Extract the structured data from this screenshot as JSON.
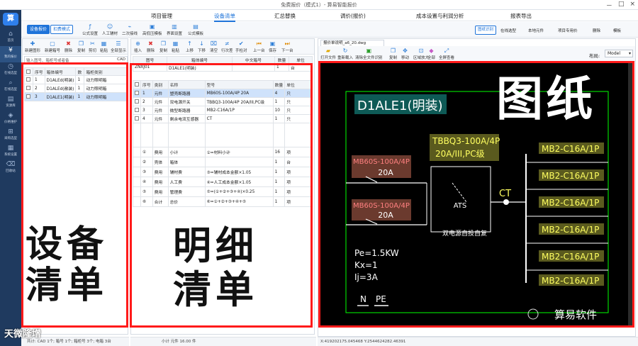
{
  "window": {
    "title": "免费报价（模式1）- 算易智能报价",
    "controls": [
      "－",
      "□",
      "×"
    ]
  },
  "nav": {
    "logo": "算",
    "items": [
      {
        "icon": "home-icon",
        "glyph": "⌂",
        "label": "首页"
      },
      {
        "icon": "quote-icon",
        "glyph": "¥",
        "label": "我的报价"
      },
      {
        "icon": "clock-icon",
        "glyph": "◷",
        "label": "在线选型"
      },
      {
        "icon": "search-icon",
        "glyph": "⌕",
        "label": "在线选型"
      },
      {
        "icon": "book-icon",
        "glyph": "▤",
        "label": "资源库"
      },
      {
        "icon": "tag-icon",
        "glyph": "◈",
        "label": "价格维护"
      },
      {
        "icon": "cart-icon",
        "glyph": "⊞",
        "label": "采购选型"
      },
      {
        "icon": "grid-icon",
        "glyph": "▦",
        "label": "系统设置"
      },
      {
        "icon": "trash-icon",
        "glyph": "⌫",
        "label": "回收站"
      }
    ]
  },
  "menu": {
    "items": [
      "项目管理",
      "设备清单",
      "汇总替换",
      "调价(报价)",
      "成本设置与利润分析",
      "报表导出"
    ],
    "active_index": 1
  },
  "mode": {
    "on": "设备报价",
    "off": "扣费模式"
  },
  "toolbar_main": [
    {
      "icon": "formula-icon",
      "label": "公式设置"
    },
    {
      "icon": "labor-icon",
      "label": "人工辅材"
    },
    {
      "icon": "secondary-icon",
      "label": "二次接线"
    },
    {
      "icon": "price-icon",
      "label": "高低压模板"
    },
    {
      "icon": "layout-icon",
      "label": "界面设置"
    },
    {
      "icon": "template-icon",
      "label": "公式模板"
    }
  ],
  "toolbar_right": [
    "图纸识别",
    "在线选型",
    "本地元件",
    "项目专用价",
    "删除",
    "模板"
  ],
  "left_toolbar": [
    "新建图形",
    "新建箱号",
    "删除",
    "复制",
    "剪切",
    "粘贴",
    "全部显示"
  ],
  "left_filter": {
    "label": "输入图号、箱柜号或者备",
    "cad": "CAD"
  },
  "left_table": {
    "headers": [
      "序号",
      "箱体编号",
      "数",
      "箱柜类别"
    ],
    "rows": [
      {
        "no": "1",
        "code": "D1ALEd(明装)",
        "qty": "1",
        "type": "动力照明箱",
        "sel": false
      },
      {
        "no": "2",
        "code": "D1ALEd(敞装)",
        "qty": "1",
        "type": "动力照明箱",
        "sel": false
      },
      {
        "no": "3",
        "code": "D1ALE1(明装)",
        "qty": "1",
        "type": "动力照明箱",
        "sel": true
      }
    ]
  },
  "mid_toolbar": [
    "插入",
    "删除",
    "复制",
    "粘贴",
    "上移",
    "下移",
    "清空",
    "行次差",
    "手检对",
    "上一台",
    "保存",
    "下一台"
  ],
  "mid_header_fields": [
    "图号",
    "箱体编号",
    "中文箱号",
    "数量",
    "单位"
  ],
  "mid_header_values": [
    "ZNXJ01",
    "D1ALE1(明装)",
    "",
    "1",
    "台"
  ],
  "mid_table": {
    "headers": [
      "序号",
      "类别",
      "名称",
      "型号",
      "数量",
      "单位"
    ],
    "rows": [
      {
        "no": "1",
        "cat": "元件",
        "name": "塑壳断路器",
        "model": "MB60S-100A/4P 20A",
        "qty": "4",
        "unit": "只",
        "sel": true
      },
      {
        "no": "2",
        "cat": "元件",
        "name": "双电源开关",
        "model": "TBBQ3-100A/4P 20A/III,PC级",
        "qty": "1",
        "unit": "只",
        "sel": false
      },
      {
        "no": "3",
        "cat": "元件",
        "name": "微型断路器",
        "model": "MB2-C16A/1P",
        "qty": "10",
        "unit": "只",
        "sel": false
      },
      {
        "no": "4",
        "cat": "元件",
        "name": "剩余电流互感器",
        "model": "CT",
        "qty": "1",
        "unit": "只",
        "sel": false
      }
    ],
    "fee_rows": [
      {
        "no": "①",
        "cat": "费用",
        "name": "小计",
        "model": "①=材料小计",
        "qty": "16",
        "unit": "项"
      },
      {
        "no": "②",
        "cat": "壳体",
        "name": "箱体",
        "model": "",
        "qty": "1",
        "unit": "台"
      },
      {
        "no": "③",
        "cat": "费用",
        "name": "辅材费",
        "model": "③=辅材成本金额×1.05",
        "qty": "1",
        "unit": "项"
      },
      {
        "no": "④",
        "cat": "费用",
        "name": "人工费",
        "model": "④=人工成本金额×1.05",
        "qty": "1",
        "unit": "项"
      },
      {
        "no": "⑤",
        "cat": "费用",
        "name": "管理费",
        "model": "⑤=(①+②+③+④)×0.25",
        "qty": "1",
        "unit": "项"
      },
      {
        "no": "⑥",
        "cat": "合计",
        "name": "总价",
        "model": "⑥=①+②+③+④+⑤",
        "qty": "1",
        "unit": "项"
      }
    ]
  },
  "drawing_tab": "报价单说明_a6_20.dwg",
  "drawing_toolbar": [
    "打开文件",
    "重新载入",
    "清除全文件识别",
    "复制",
    "移动",
    "区域放大",
    "全部",
    "全屏查看"
  ],
  "layout_label": "布局:",
  "layout_value": "Model",
  "overlay": {
    "left": [
      "设",
      "备",
      "清",
      "单"
    ],
    "mid": [
      "明",
      "细",
      "清",
      "单"
    ],
    "right": "图纸"
  },
  "drawing": {
    "box_title": "D1ALE1(明装)",
    "breaker1": [
      "MB60S-100A/4P",
      "20A"
    ],
    "breaker2": [
      "MB60S-100A/4P",
      "20A"
    ],
    "ats_label": [
      "TBBQ3-100A/4P",
      "20A/III,PC级"
    ],
    "ats_text": "ATS",
    "ats_caption": "双电源自投自复",
    "ct": "CT",
    "outputs": [
      "MB2-C16A/1P",
      "MB2-C16A/1P",
      "MB2-C16A/1P",
      "MB2-C16A/1P",
      "MB2-C16A/1P",
      "MB2-C16A/1P"
    ],
    "params": [
      "Pe=1.5KW",
      "Kx=1",
      "Ij=3A"
    ],
    "n": "N",
    "pe": "PE",
    "watermark": "算易软件"
  },
  "status": {
    "left": "共计: CAD 1个; 箱号 1个; 箱柜号 3个; 电箱 3台",
    "mid": "小计 元件 16.00 件",
    "right": "X:419202175.045468 Y:2544624282.46391",
    "brand": "天微隆增"
  },
  "colors": {
    "accent": "#1e73d9",
    "nav": "#1f3a5f",
    "red": "#ff1a1a",
    "cad_green": "#00ff00",
    "cad_yellow": "#ffff00"
  }
}
